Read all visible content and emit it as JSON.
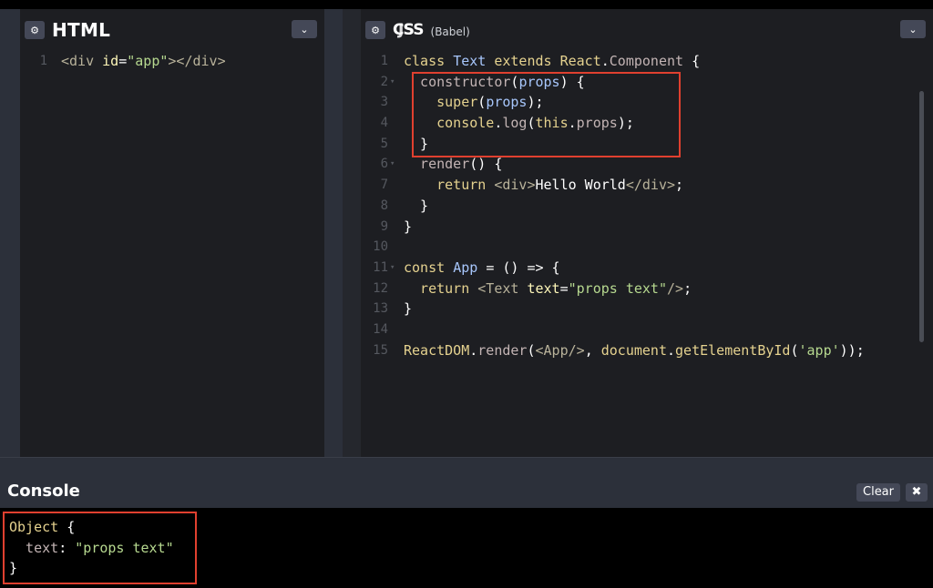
{
  "html_panel": {
    "title": "HTML",
    "gear_icon": "⚙",
    "chevron_icon": "⌄",
    "lines": [
      {
        "n": "1",
        "tokens": [
          {
            "t": "<div ",
            "c": "tag"
          },
          {
            "t": "id",
            "c": "attr"
          },
          {
            "t": "=",
            "c": "punc"
          },
          {
            "t": "\"app\"",
            "c": "str"
          },
          {
            "t": "></div>",
            "c": "tag"
          }
        ]
      }
    ]
  },
  "js_panel": {
    "title": "CSS",
    "overlay_title": "JS",
    "subtitle": "(Babel)",
    "gear_icon": "⚙",
    "chevron_icon": "⌄",
    "lines": [
      {
        "n": "1",
        "fold": "",
        "tokens": [
          {
            "t": "class ",
            "c": "kw"
          },
          {
            "t": "Text ",
            "c": "cls"
          },
          {
            "t": "extends ",
            "c": "kw"
          },
          {
            "t": "React",
            "c": "kw"
          },
          {
            "t": ".",
            "c": "punc"
          },
          {
            "t": "Component",
            "c": "muted"
          },
          {
            "t": " {",
            "c": "punc"
          }
        ]
      },
      {
        "n": "2",
        "fold": "▾",
        "tokens": [
          {
            "t": "  constructor",
            "c": "muted"
          },
          {
            "t": "(",
            "c": "punc"
          },
          {
            "t": "props",
            "c": "cls"
          },
          {
            "t": ") {",
            "c": "punc"
          }
        ]
      },
      {
        "n": "3",
        "fold": "",
        "tokens": [
          {
            "t": "    super",
            "c": "kw"
          },
          {
            "t": "(",
            "c": "punc"
          },
          {
            "t": "props",
            "c": "cls"
          },
          {
            "t": ");",
            "c": "punc"
          }
        ]
      },
      {
        "n": "4",
        "fold": "",
        "tokens": [
          {
            "t": "    console",
            "c": "kw"
          },
          {
            "t": ".",
            "c": "punc"
          },
          {
            "t": "log",
            "c": "muted"
          },
          {
            "t": "(",
            "c": "punc"
          },
          {
            "t": "this",
            "c": "kw"
          },
          {
            "t": ".",
            "c": "punc"
          },
          {
            "t": "props",
            "c": "muted"
          },
          {
            "t": ");",
            "c": "punc"
          }
        ]
      },
      {
        "n": "5",
        "fold": "",
        "tokens": [
          {
            "t": "  }",
            "c": "punc"
          }
        ]
      },
      {
        "n": "6",
        "fold": "▾",
        "tokens": [
          {
            "t": "  render",
            "c": "muted"
          },
          {
            "t": "() {",
            "c": "punc"
          }
        ]
      },
      {
        "n": "7",
        "fold": "",
        "tokens": [
          {
            "t": "    return ",
            "c": "kw"
          },
          {
            "t": "<div>",
            "c": "tag"
          },
          {
            "t": "Hello World",
            "c": "punc"
          },
          {
            "t": "</div>",
            "c": "tag"
          },
          {
            "t": ";",
            "c": "punc"
          }
        ]
      },
      {
        "n": "8",
        "fold": "",
        "tokens": [
          {
            "t": "  }",
            "c": "punc"
          }
        ]
      },
      {
        "n": "9",
        "fold": "",
        "tokens": [
          {
            "t": "}",
            "c": "punc"
          }
        ]
      },
      {
        "n": "10",
        "fold": "",
        "tokens": []
      },
      {
        "n": "11",
        "fold": "▾",
        "tokens": [
          {
            "t": "const ",
            "c": "kw"
          },
          {
            "t": "App ",
            "c": "cls"
          },
          {
            "t": "= () => {",
            "c": "punc"
          }
        ]
      },
      {
        "n": "12",
        "fold": "",
        "tokens": [
          {
            "t": "  return ",
            "c": "kw"
          },
          {
            "t": "<Text ",
            "c": "tag"
          },
          {
            "t": "text",
            "c": "attr"
          },
          {
            "t": "=",
            "c": "punc"
          },
          {
            "t": "\"props text\"",
            "c": "str"
          },
          {
            "t": "/>",
            "c": "tag"
          },
          {
            "t": ";",
            "c": "punc"
          }
        ]
      },
      {
        "n": "13",
        "fold": "",
        "tokens": [
          {
            "t": "}",
            "c": "punc"
          }
        ]
      },
      {
        "n": "14",
        "fold": "",
        "tokens": []
      },
      {
        "n": "15",
        "fold": "",
        "tokens": [
          {
            "t": "ReactDOM",
            "c": "kw"
          },
          {
            "t": ".",
            "c": "punc"
          },
          {
            "t": "render",
            "c": "muted"
          },
          {
            "t": "(",
            "c": "punc"
          },
          {
            "t": "<App/>",
            "c": "tag"
          },
          {
            "t": ", ",
            "c": "punc"
          },
          {
            "t": "document",
            "c": "kw"
          },
          {
            "t": ".",
            "c": "punc"
          },
          {
            "t": "getElementById",
            "c": "kw"
          },
          {
            "t": "(",
            "c": "punc"
          },
          {
            "t": "'app'",
            "c": "str"
          },
          {
            "t": "));",
            "c": "punc"
          }
        ]
      }
    ]
  },
  "console": {
    "title": "Console",
    "clear_label": "Clear",
    "close_icon": "✖",
    "lines": [
      [
        {
          "t": "Object ",
          "c": "kw"
        },
        {
          "t": "{",
          "c": "punc"
        }
      ],
      [
        {
          "t": "  text",
          "c": "muted"
        },
        {
          "t": ": ",
          "c": "punc"
        },
        {
          "t": "\"props text\"",
          "c": "str"
        }
      ],
      [
        {
          "t": "}",
          "c": "punc"
        }
      ]
    ]
  },
  "colors": {
    "highlight": "#e0402f",
    "panel_bg": "#1d1e22",
    "console_bg": "#000000"
  }
}
